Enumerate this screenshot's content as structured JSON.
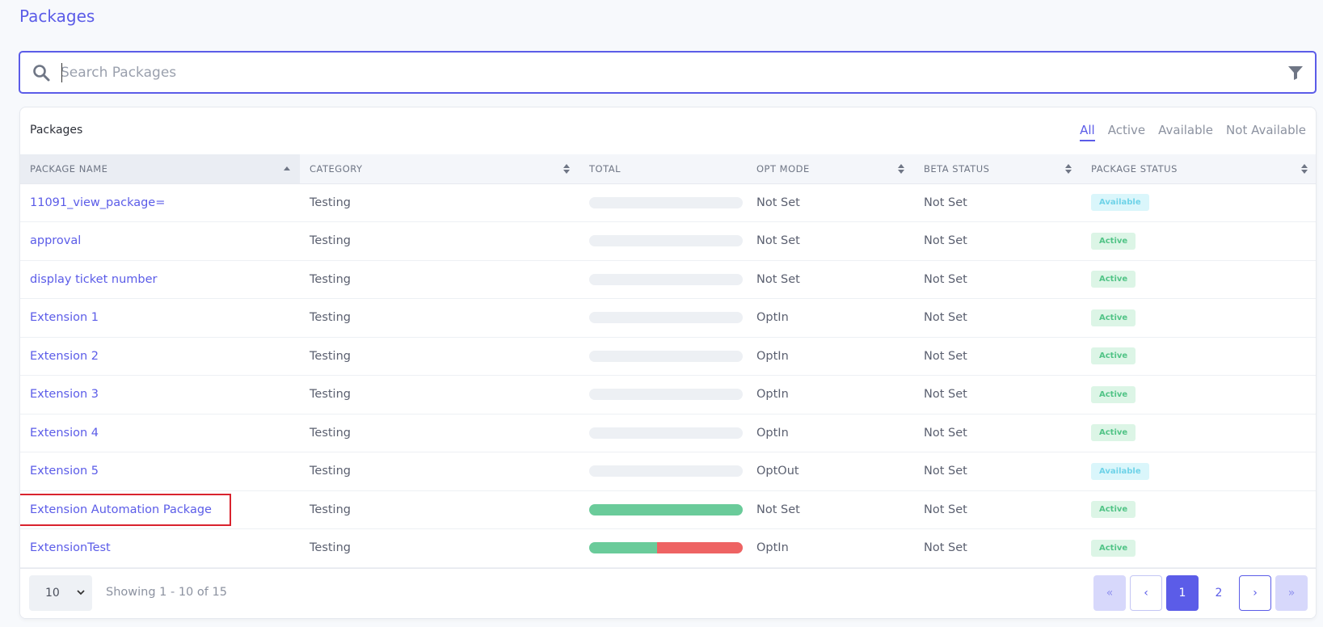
{
  "page": {
    "title": "Packages"
  },
  "search": {
    "placeholder": "Search Packages",
    "value": ""
  },
  "card": {
    "title": "Packages",
    "filters": [
      "All",
      "Active",
      "Available",
      "Not Available"
    ],
    "active_filter": "All"
  },
  "table": {
    "columns": [
      "PACKAGE NAME",
      "CATEGORY",
      "TOTAL",
      "OPT MODE",
      "BETA STATUS",
      "PACKAGE STATUS"
    ],
    "rows": [
      {
        "name": "11091_view_package=",
        "category": "Testing",
        "total": [],
        "opt_mode": "Not Set",
        "beta_status": "Not Set",
        "status": "Available"
      },
      {
        "name": "approval",
        "category": "Testing",
        "total": [],
        "opt_mode": "Not Set",
        "beta_status": "Not Set",
        "status": "Active"
      },
      {
        "name": "display ticket number",
        "category": "Testing",
        "total": [],
        "opt_mode": "Not Set",
        "beta_status": "Not Set",
        "status": "Active"
      },
      {
        "name": "Extension 1",
        "category": "Testing",
        "total": [],
        "opt_mode": "OptIn",
        "beta_status": "Not Set",
        "status": "Active"
      },
      {
        "name": "Extension 2",
        "category": "Testing",
        "total": [],
        "opt_mode": "OptIn",
        "beta_status": "Not Set",
        "status": "Active"
      },
      {
        "name": "Extension 3",
        "category": "Testing",
        "total": [],
        "opt_mode": "OptIn",
        "beta_status": "Not Set",
        "status": "Active"
      },
      {
        "name": "Extension 4",
        "category": "Testing",
        "total": [],
        "opt_mode": "OptIn",
        "beta_status": "Not Set",
        "status": "Active"
      },
      {
        "name": "Extension 5",
        "category": "Testing",
        "total": [],
        "opt_mode": "OptOut",
        "beta_status": "Not Set",
        "status": "Available"
      },
      {
        "name": "Extension Automation Package",
        "category": "Testing",
        "total": [
          {
            "fraction": 1.0,
            "color": "#6acb9a"
          }
        ],
        "opt_mode": "Not Set",
        "beta_status": "Not Set",
        "status": "Active",
        "highlighted": true
      },
      {
        "name": "ExtensionTest",
        "category": "Testing",
        "total": [
          {
            "fraction": 0.44,
            "color": "#6acb9a"
          },
          {
            "fraction": 0.56,
            "color": "#ee6363"
          }
        ],
        "opt_mode": "OptIn",
        "beta_status": "Not Set",
        "status": "Active"
      }
    ]
  },
  "footer": {
    "page_size": "10",
    "showing": "Showing 1 - 10 of 15",
    "pages": [
      "1",
      "2"
    ],
    "current_page": "1",
    "first_label": "«",
    "prev_label": "‹",
    "next_label": "›",
    "last_label": "»"
  },
  "colors": {
    "accent": "#5b5ce8",
    "highlight": "#d9232e",
    "active_badge": "#52c487",
    "available_badge": "#6fd3e8"
  }
}
